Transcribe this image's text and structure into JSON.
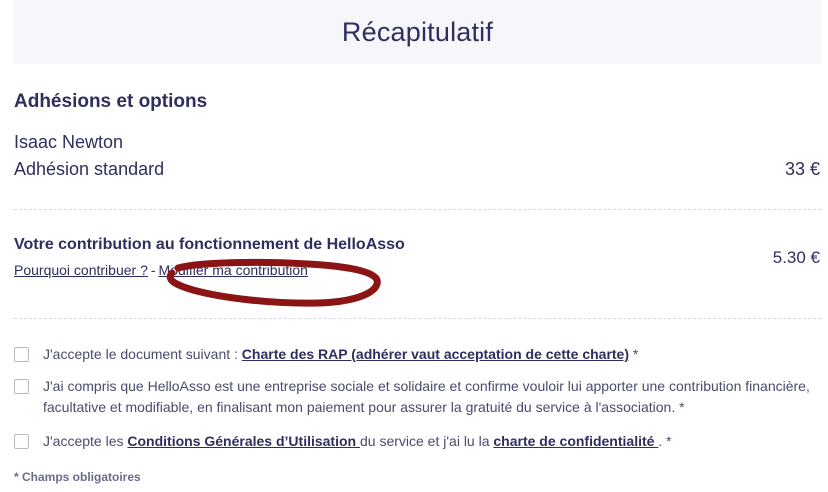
{
  "header": {
    "title": "Récapitulatif"
  },
  "memberships": {
    "section_title": "Adhésions et options",
    "person_name": "Isaac Newton",
    "item_label": "Adhésion standard",
    "item_price": "33 €"
  },
  "contribution": {
    "title": "Votre contribution au fonctionnement de HelloAsso",
    "why_link": "Pourquoi contribuer ?",
    "separator": "-",
    "modify_link": "Modifier ma contribution",
    "amount": "5.30 €"
  },
  "consents": {
    "rap": {
      "prefix": "J'accepte le document suivant : ",
      "link": "Charte des RAP (adhérer vaut acceptation de cette charte)",
      "suffix": " *"
    },
    "helloasso": {
      "text": "J'ai compris que HelloAsso est une entreprise sociale et solidaire et confirme vouloir lui apporter une contribution financière, facultative et modifiable, en finalisant mon paiement pour assurer la gratuité du service à l'association. *"
    },
    "cgu": {
      "prefix": "J'accepte les ",
      "link1": "Conditions Générales d’Utilisation ",
      "middle": "du service et j'ai lu la ",
      "link2": "charte de confidentialité ",
      "suffix": ". *"
    }
  },
  "required_note": "* Champs obligatoires",
  "colors": {
    "primary_text": "#2e2f5e",
    "header_bg": "#f6f6fb",
    "scribble": "#8b1414"
  }
}
